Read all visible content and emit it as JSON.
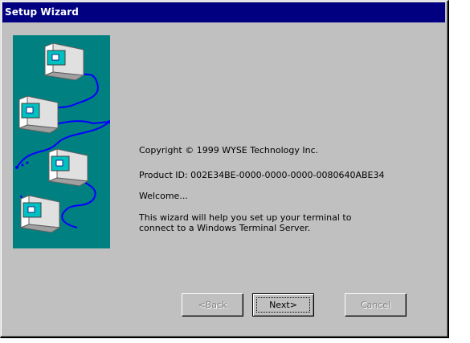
{
  "window": {
    "title": "Setup Wizard"
  },
  "side_image": {
    "icon": "networked-terminals-illustration",
    "background": "#008080"
  },
  "content": {
    "copyright": "Copyright ©  1999 WYSE Technology Inc.",
    "product_id": "Product ID: 002E34BE-0000-0000-0000-0080640ABE34",
    "welcome": "Welcome...",
    "description_line1": "This wizard will help you set up your terminal to",
    "description_line2": "connect to a Windows Terminal Server."
  },
  "buttons": {
    "back_label": "<Back",
    "next_label": "Next>",
    "cancel_label": "Cancel"
  },
  "colors": {
    "title_bar": "#000080",
    "window_face": "#c0c0c0",
    "disabled_text": "#808080"
  }
}
